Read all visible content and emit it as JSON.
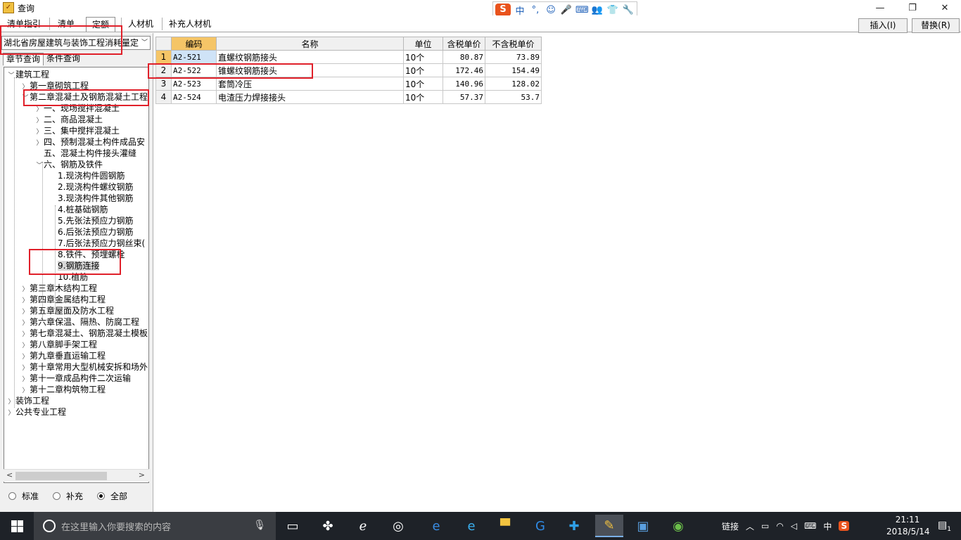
{
  "window": {
    "title": "查询",
    "minimize": "—",
    "restore": "❐",
    "close": "✕"
  },
  "ime": {
    "logo": "S",
    "items": [
      "中",
      "°,",
      "☺",
      "🎤",
      "⌨",
      "👥",
      "👕",
      "🔧"
    ]
  },
  "tabs": [
    {
      "label": "清单指引"
    },
    {
      "label": "清单"
    },
    {
      "label": "定额"
    },
    {
      "label": "人材机"
    },
    {
      "label": "补充人材机"
    }
  ],
  "toolbar": {
    "insert": "插入(I)",
    "replace": "替换(R)"
  },
  "left": {
    "quota_db": "湖北省房屋建筑与装饰工程消耗量定",
    "subtabs": [
      "章节查询",
      "条件查询"
    ],
    "tree": [
      {
        "label": "建筑工程"
      },
      {
        "label": "第一章砌筑工程"
      },
      {
        "label": "第二章混凝土及钢筋混凝土工程"
      },
      {
        "label": "一、现场搅拌混凝土"
      },
      {
        "label": "二、商品混凝土"
      },
      {
        "label": "三、集中搅拌混凝土"
      },
      {
        "label": "四、预制混凝土构件成品安"
      },
      {
        "label": "五、混凝土构件接头灌缝"
      },
      {
        "label": "六、钢筋及铁件"
      },
      {
        "label": "1.现浇构件圆钢筋"
      },
      {
        "label": "2.现浇构件螺纹钢筋"
      },
      {
        "label": "3.现浇构件其他钢筋"
      },
      {
        "label": "4.桩基础钢筋"
      },
      {
        "label": "5.先张法预应力钢筋"
      },
      {
        "label": "6.后张法预应力钢筋"
      },
      {
        "label": "7.后张法预应力钢丝束("
      },
      {
        "label": "8.铁件、预埋螺栓"
      },
      {
        "label": "9.钢筋连接"
      },
      {
        "label": "10.植筋"
      },
      {
        "label": "第三章木结构工程"
      },
      {
        "label": "第四章金属结构工程"
      },
      {
        "label": "第五章屋面及防水工程"
      },
      {
        "label": "第六章保温、隔热、防腐工程"
      },
      {
        "label": "第七章混凝土、钢筋混凝土模板"
      },
      {
        "label": "第八章脚手架工程"
      },
      {
        "label": "第九章垂直运输工程"
      },
      {
        "label": "第十章常用大型机械安拆和场外"
      },
      {
        "label": "第十一章成品构件二次运输"
      },
      {
        "label": "第十二章构筑物工程"
      },
      {
        "label": "装饰工程"
      },
      {
        "label": "公共专业工程"
      }
    ],
    "radios": [
      {
        "label": "标准",
        "checked": false
      },
      {
        "label": "补充",
        "checked": false
      },
      {
        "label": "全部",
        "checked": true
      }
    ]
  },
  "grid": {
    "headers": [
      "编码",
      "名称",
      "单位",
      "含税单价",
      "不含税单价"
    ],
    "rows": [
      {
        "no": "1",
        "code": "A2-521",
        "name": "直螺纹钢筋接头",
        "unit": "10个",
        "tax_price": "80.87",
        "notax_price": "73.89"
      },
      {
        "no": "2",
        "code": "A2-522",
        "name": "锥螺纹钢筋接头",
        "unit": "10个",
        "tax_price": "172.46",
        "notax_price": "154.49"
      },
      {
        "no": "3",
        "code": "A2-523",
        "name": "套筒冷压",
        "unit": "10个",
        "tax_price": "140.96",
        "notax_price": "128.02"
      },
      {
        "no": "4",
        "code": "A2-524",
        "name": "电渣压力焊接接头",
        "unit": "10个",
        "tax_price": "57.37",
        "notax_price": "53.7"
      }
    ]
  },
  "taskbar": {
    "search_placeholder": "在这里输入你要搜索的内容",
    "tray_link": "链接",
    "tray_ime": "中",
    "time": "21:11",
    "date": "2018/5/14",
    "notif_count": "1"
  },
  "colors": {
    "accent_header": "#f5c567",
    "selection": "#cfe3f7",
    "annotation_red": "#e0202a",
    "taskbar_bg": "#1e2228"
  }
}
